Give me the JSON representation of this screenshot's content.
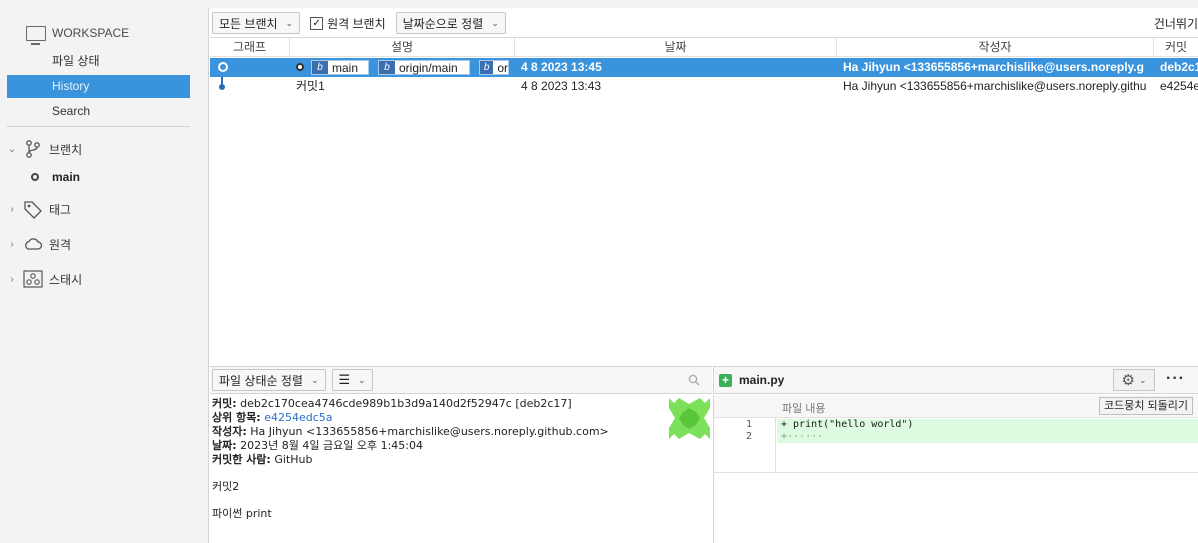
{
  "sidebar": {
    "workspace_label": "WORKSPACE",
    "nav": [
      {
        "label": "파일 상태"
      },
      {
        "label": "History"
      },
      {
        "label": "Search"
      }
    ],
    "branches_label": "브랜치",
    "branch_main": "main",
    "tags_label": "태그",
    "remotes_label": "원격",
    "stashes_label": "스태시"
  },
  "toolbar": {
    "all_branches": "모든 브랜치",
    "remote_branches": "원격 브랜치",
    "remote_branches_checked": true,
    "sort_date": "날짜순으로 정렬",
    "skip": "건너뛰기"
  },
  "table": {
    "columns": [
      "그래프",
      "설명",
      "날짜",
      "작성자",
      "커밋"
    ],
    "rows": [
      {
        "refs": [
          "main",
          "origin/main",
          "or"
        ],
        "description": "",
        "date": "4 8 2023 13:45",
        "author": "Ha Jihyun <133655856+marchislike@users.noreply.g",
        "commit": "deb2c1",
        "selected": true
      },
      {
        "refs": [],
        "description": "커밋1",
        "date": "4 8 2023 13:43",
        "author": "Ha Jihyun <133655856+marchislike@users.noreply.githu",
        "commit": "e4254e",
        "selected": false
      }
    ]
  },
  "bottom_left": {
    "sort_files": "파일 상태순 정렬",
    "list_icon": "list-icon",
    "commit_label": "커밋:",
    "commit_value": "deb2c170cea4746cde989b1b3d9a140d2f52947c [deb2c17]",
    "parent_label": "상위 항목:",
    "parent_value": "e4254edc5a",
    "author_label": "작성자:",
    "author_value": "Ha Jihyun <133655856+marchislike@users.noreply.github.com>",
    "date_label": "날짜:",
    "date_value": "2023년 8월 4일 금요일 오후 1:45:04",
    "committer_label": "커밋한 사람:",
    "committer_value": "GitHub",
    "message_line1": "커밋2",
    "message_line2": "파이썬 print"
  },
  "bottom_right": {
    "file_name": "main.py",
    "hunk_label": "파일 내용",
    "revert_button": "코드뭉치 되돌리기",
    "lines": [
      {
        "num": "1",
        "code": "+ print(\"hello world\")"
      },
      {
        "num": "2",
        "code": "+······"
      }
    ]
  },
  "colors": {
    "selection": "#3a93dd",
    "added_bg": "#dcfbe1",
    "ref_icon": "#3a6fb0",
    "avatar": "#7ce05b"
  }
}
